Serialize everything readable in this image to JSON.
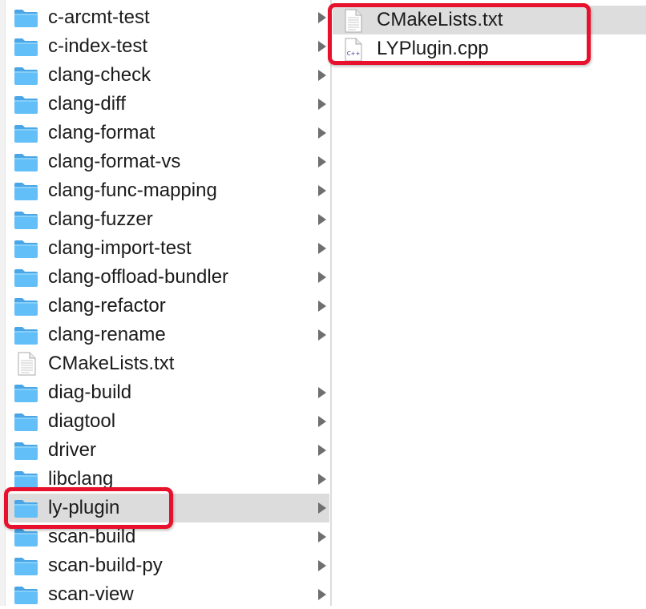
{
  "left_column": {
    "items": [
      {
        "label": "c-arcmt-test",
        "type": "folder",
        "has_children": true
      },
      {
        "label": "c-index-test",
        "type": "folder",
        "has_children": true
      },
      {
        "label": "clang-check",
        "type": "folder",
        "has_children": true
      },
      {
        "label": "clang-diff",
        "type": "folder",
        "has_children": true
      },
      {
        "label": "clang-format",
        "type": "folder",
        "has_children": true
      },
      {
        "label": "clang-format-vs",
        "type": "folder",
        "has_children": true
      },
      {
        "label": "clang-func-mapping",
        "type": "folder",
        "has_children": true
      },
      {
        "label": "clang-fuzzer",
        "type": "folder",
        "has_children": true
      },
      {
        "label": "clang-import-test",
        "type": "folder",
        "has_children": true
      },
      {
        "label": "clang-offload-bundler",
        "type": "folder",
        "has_children": true
      },
      {
        "label": "clang-refactor",
        "type": "folder",
        "has_children": true
      },
      {
        "label": "clang-rename",
        "type": "folder",
        "has_children": true
      },
      {
        "label": "CMakeLists.txt",
        "type": "text-file",
        "has_children": false
      },
      {
        "label": "diag-build",
        "type": "folder",
        "has_children": true
      },
      {
        "label": "diagtool",
        "type": "folder",
        "has_children": true
      },
      {
        "label": "driver",
        "type": "folder",
        "has_children": true
      },
      {
        "label": "libclang",
        "type": "folder",
        "has_children": true
      },
      {
        "label": "ly-plugin",
        "type": "folder",
        "has_children": true,
        "selected": true,
        "highlighted": true
      },
      {
        "label": "scan-build",
        "type": "folder",
        "has_children": true
      },
      {
        "label": "scan-build-py",
        "type": "folder",
        "has_children": true
      },
      {
        "label": "scan-view",
        "type": "folder",
        "has_children": true
      }
    ]
  },
  "right_column": {
    "items": [
      {
        "label": "CMakeLists.txt",
        "type": "text-file",
        "selected": true
      },
      {
        "label": "LYPlugin.cpp",
        "type": "cpp-file",
        "icon_text": "C++"
      }
    ]
  },
  "colors": {
    "folder_body": "#62bff7",
    "folder_tab": "#4aa6e6",
    "selection": "#dcdcdc",
    "highlight": "#e8112d",
    "chevron": "#6f6f6f"
  }
}
